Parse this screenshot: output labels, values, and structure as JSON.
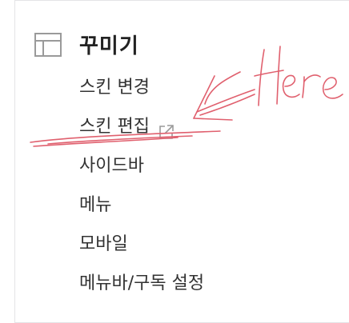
{
  "section": {
    "title": "꾸미기",
    "icon": "layout-icon"
  },
  "menu": {
    "items": [
      {
        "label": "스킨 변경"
      },
      {
        "label": "스킨 편집",
        "external_icon": "external-link-icon"
      },
      {
        "label": "사이드바"
      },
      {
        "label": "메뉴"
      },
      {
        "label": "모바일"
      },
      {
        "label": "메뉴바/구독 설정"
      }
    ]
  },
  "annotation": {
    "text": "Here",
    "color": "#e0606e"
  },
  "colors": {
    "border": "#e4e4e6",
    "text": "#333333",
    "icon": "#9a9a9a"
  }
}
